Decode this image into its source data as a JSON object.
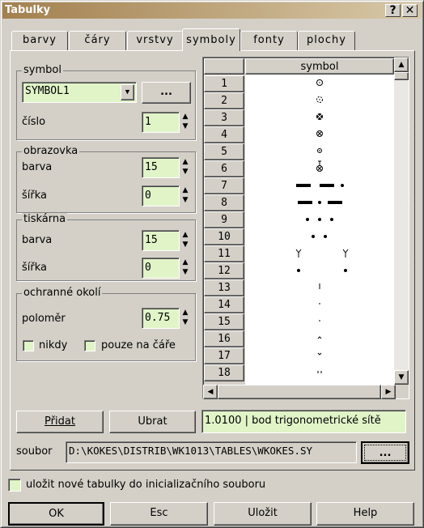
{
  "window": {
    "title": "Tabulky",
    "help_button": "?",
    "close_button": "✕"
  },
  "tabs": [
    {
      "label": "barvy"
    },
    {
      "label": "čáry"
    },
    {
      "label": "vrstvy"
    },
    {
      "label": "symboly",
      "active": true
    },
    {
      "label": "fonty"
    },
    {
      "label": "plochy"
    }
  ],
  "symbol_group": {
    "title": "symbol",
    "combo_value": "SYMBOL1",
    "browse_label": "...",
    "cislo_label": "číslo",
    "cislo_value": "1"
  },
  "obrazovka": {
    "title": "obrazovka",
    "barva_label": "barva",
    "barva_value": "15",
    "sirka_label": "šířka",
    "sirka_value": "0"
  },
  "tiskarna": {
    "title": "tiskárna",
    "barva_label": "barva",
    "barva_value": "15",
    "sirka_label": "šířka",
    "sirka_value": "0"
  },
  "okoli": {
    "title": "ochranné okolí",
    "polomer_label": "poloměr",
    "polomer_value": "0.75",
    "nikdy_label": "nikdy",
    "nikdy_checked": false,
    "pouze_label": "pouze na čáře",
    "pouze_checked": false
  },
  "grid": {
    "column_header": "symbol",
    "rows": [
      {
        "num": "1",
        "icon": "circle-dot-icon"
      },
      {
        "num": "2",
        "icon": "dashed-circle-dot-icon"
      },
      {
        "num": "3",
        "icon": "filled-cross-circle-icon"
      },
      {
        "num": "4",
        "icon": "cross-circle-icon"
      },
      {
        "num": "5",
        "icon": "small-circle-minus-icon"
      },
      {
        "num": "6",
        "icon": "stem-cross-circle-icon"
      },
      {
        "num": "7",
        "icon": "dash-dash-dot-icon"
      },
      {
        "num": "8",
        "icon": "dash-dot-dash-icon"
      },
      {
        "num": "9",
        "icon": "three-dots-icon"
      },
      {
        "num": "10",
        "icon": "two-dots-icon"
      },
      {
        "num": "11",
        "icon": "two-antenna-icon"
      },
      {
        "num": "12",
        "icon": "two-wide-dots-icon"
      },
      {
        "num": "13",
        "icon": "vertical-bar-icon"
      },
      {
        "num": "14",
        "icon": "small-tick-icon"
      },
      {
        "num": "15",
        "icon": "small-tick-icon"
      },
      {
        "num": "16",
        "icon": "caret-up-icon"
      },
      {
        "num": "17",
        "icon": "caret-down-icon"
      },
      {
        "num": "18",
        "icon": "double-tick-icon"
      }
    ]
  },
  "actions": {
    "add_label": "Přidat",
    "remove_label": "Ubrat",
    "info": "1.0100 | bod trigonometrické sítě"
  },
  "file": {
    "label": "soubor",
    "path": "D:\\KOKES\\DISTRIB\\WK1013\\TABLES\\WKOKES.SY",
    "browse_label": "..."
  },
  "save_ini": {
    "label": "uložit nové tabulky do inicializačního souboru",
    "checked": false
  },
  "footer": {
    "ok": "OK",
    "esc": "Esc",
    "save": "Uložit",
    "help": "Help"
  },
  "colors": {
    "field_bg": "#e0f4c8",
    "face": "#d4d0c8",
    "title_start": "#a3804f",
    "title_end": "#d8c9a8"
  }
}
